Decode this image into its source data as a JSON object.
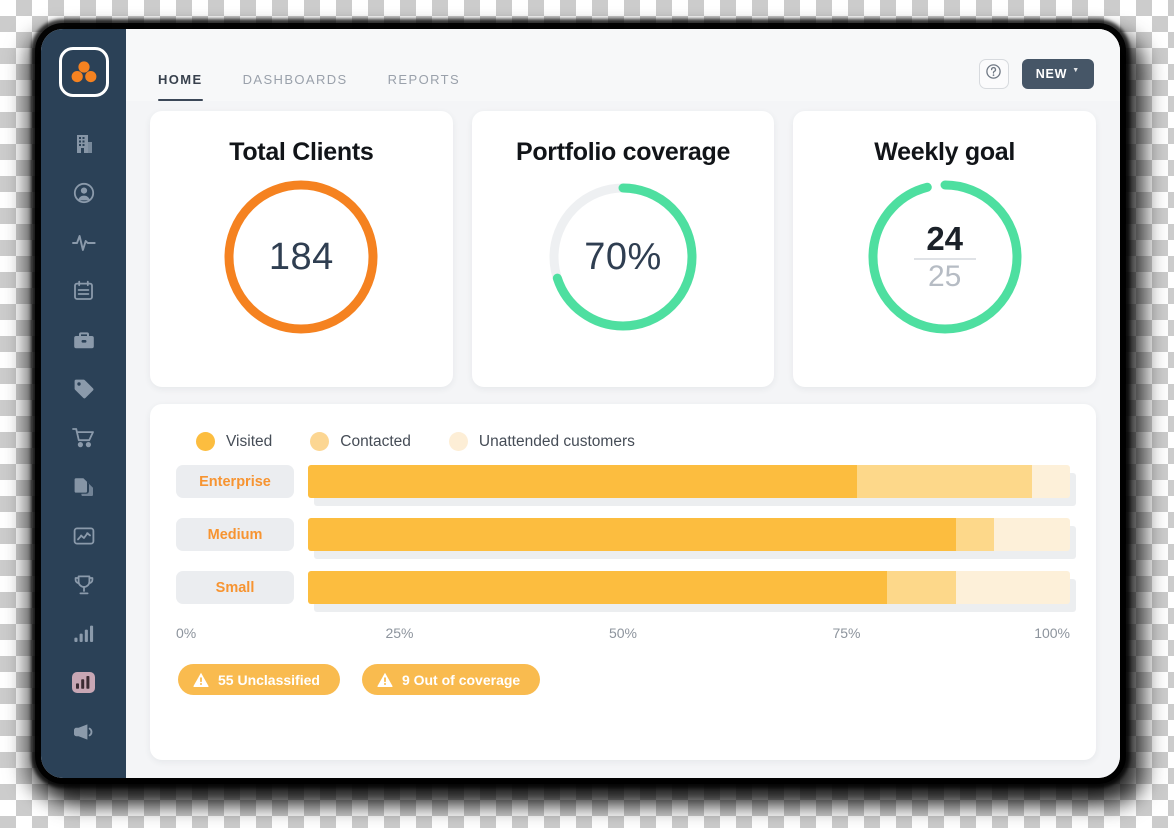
{
  "sidebar": {
    "logo_name": "three-dots-logo",
    "logo_color": "#f58220",
    "background": "#2b4157",
    "items": [
      {
        "icon": "building-icon",
        "label": "Companies"
      },
      {
        "icon": "user-circle-icon",
        "label": "Contacts"
      },
      {
        "icon": "activity-pulse-icon",
        "label": "Activity"
      },
      {
        "icon": "calendar-list-icon",
        "label": "Agenda"
      },
      {
        "icon": "briefcase-icon",
        "label": "Deals"
      },
      {
        "icon": "tag-icon",
        "label": "Products"
      },
      {
        "icon": "shopping-cart-icon",
        "label": "Orders"
      },
      {
        "icon": "documents-icon",
        "label": "Documents"
      },
      {
        "icon": "chart-box-icon",
        "label": "Analytics"
      },
      {
        "icon": "trophy-icon",
        "label": "Goals"
      },
      {
        "icon": "bar-chart-icon",
        "label": "Statistics"
      },
      {
        "icon": "bar-chart-highlighted-icon",
        "label": "Reports",
        "active": true
      },
      {
        "icon": "megaphone-icon",
        "label": "Campaigns"
      }
    ]
  },
  "topbar": {
    "tabs": [
      {
        "label": "HOME",
        "active": true
      },
      {
        "label": "DASHBOARDS",
        "active": false
      },
      {
        "label": "REPORTS",
        "active": false
      }
    ],
    "help_icon": "question-mark-circle-icon",
    "new_label": "NEW",
    "new_caret": "▼"
  },
  "kpi": [
    {
      "title": "Total Clients",
      "value": "184",
      "percent": 100,
      "color": "#f58220",
      "track": "#f58220"
    },
    {
      "title": "Portfolio coverage",
      "value": "70%",
      "percent": 70,
      "color": "#4edfa0",
      "track": "#eef0f2"
    },
    {
      "title": "Weekly goal",
      "value_numerator": "24",
      "value_denominator": "25",
      "percent": 96,
      "color": "#4edfa0",
      "track": "#ffffff"
    }
  ],
  "chart_data": {
    "type": "bar",
    "title": "",
    "orientation": "horizontal",
    "stacked": true,
    "categories": [
      "Enterprise",
      "Medium",
      "Small"
    ],
    "series": [
      {
        "name": "Visited",
        "color": "#fcbd3f",
        "values": [
          72,
          85,
          76
        ]
      },
      {
        "name": "Contacted",
        "color": "#fdd88a",
        "values": [
          23,
          5,
          9
        ]
      },
      {
        "name": "Unattended customers",
        "color": "#fdf0d9",
        "values": [
          5,
          10,
          15
        ]
      }
    ],
    "xlabel": "",
    "ylabel": "",
    "xlim": [
      0,
      100
    ],
    "xticks": [
      "0%",
      "25%",
      "50%",
      "75%",
      "100%"
    ],
    "grid": false,
    "legend_position": "top-left"
  },
  "badges": [
    {
      "icon": "warning-triangle-icon",
      "label": "55 Unclassified",
      "color": "#f9bb4f"
    },
    {
      "icon": "warning-triangle-icon",
      "label": "9 Out of coverage",
      "color": "#f9bb4f"
    }
  ]
}
